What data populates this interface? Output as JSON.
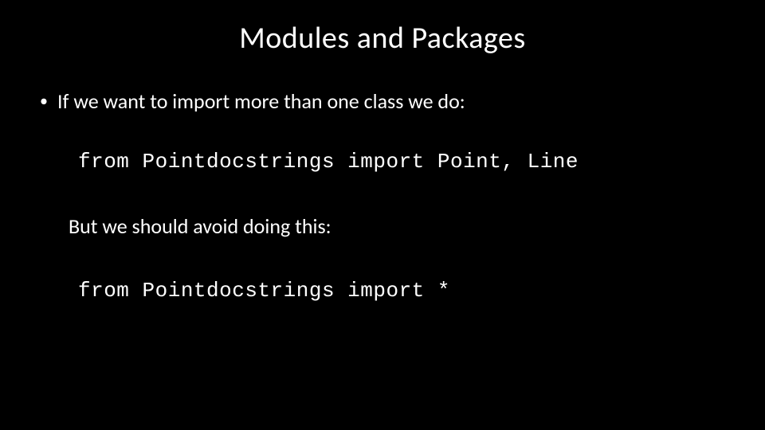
{
  "slide": {
    "title": "Modules and Packages",
    "bullet1": "If we want to import more than one class we do:",
    "code1": "from Pointdocstrings import Point, Line",
    "body1": "But we should avoid doing this:",
    "code2": "from Pointdocstrings import *"
  }
}
